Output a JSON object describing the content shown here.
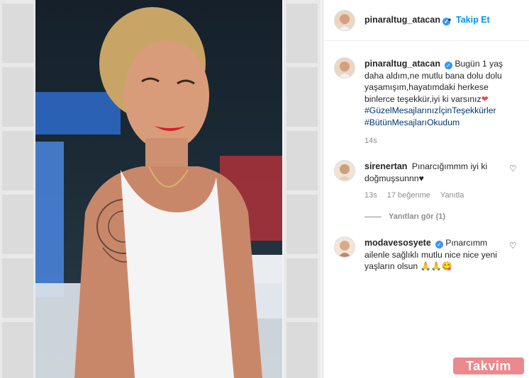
{
  "colors": {
    "accent": "#0095f6",
    "verified": "#3897f0",
    "hashtag": "#00376b",
    "heart_red": "#ed4956"
  },
  "header": {
    "username": "pinaraltug_atacan",
    "verified_icon": "verified-badge-icon",
    "separator": "•",
    "follow_label": "Takip Et"
  },
  "caption": {
    "username": "pinaraltug_atacan",
    "text": "Bugün 1 yaş daha aldım,ne mutlu bana dolu dolu yaşamışım,hayatımdaki herkese binlerce teşekkür,iyi ki varsınız",
    "emoji": "❤",
    "hashtags": [
      "#GüzelMesajlarınızİçinTeşekkürler",
      "#BütünMesajlarıOkudum"
    ],
    "time": "14s"
  },
  "comments": [
    {
      "username": "sirenertan",
      "verified": false,
      "text": "Pınarcığımmm iyi ki doğmuşsunnn♥",
      "time": "13s",
      "likes": "17 beğenme",
      "reply_label": "Yanıtla",
      "view_replies": "Yanıtları gör (1)"
    },
    {
      "username": "modavesosyete",
      "verified": true,
      "text": "Pınarcımm ailenle sağlıklı mutlu nice nice yeni yaşların olsun 🙏🙏😋"
    }
  ],
  "watermark": "Takvim"
}
